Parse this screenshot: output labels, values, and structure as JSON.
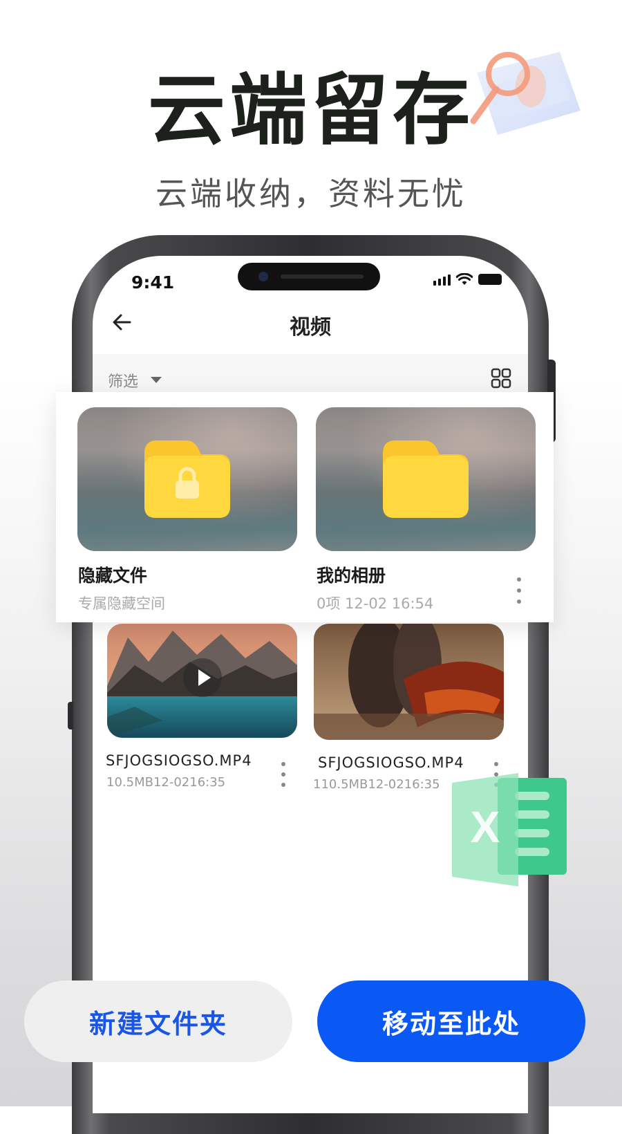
{
  "hero": {
    "title": "云端留存",
    "subtitle": "云端收纳，资料无忧"
  },
  "status_bar": {
    "time": "9:41"
  },
  "nav": {
    "title": "视频"
  },
  "filter": {
    "label": "筛选"
  },
  "folders": [
    {
      "name": "隐藏文件",
      "sub": "专属隐藏空间",
      "icon": "locked-folder-icon"
    },
    {
      "name": "我的相册",
      "sub": "0项 12-02 16:54",
      "icon": "folder-icon"
    }
  ],
  "videos": [
    {
      "name": "SFJOGSIOGSO.MP4",
      "meta": "10.5MB12-0216:35"
    },
    {
      "name": "SFJOGSIOGSO.MP4",
      "meta": "110.5MB12-0216:35"
    }
  ],
  "actions": {
    "new_folder": "新建文件夹",
    "move_here": "移动至此处"
  },
  "colors": {
    "primary": "#0a59f5",
    "folder_yellow": "#ffd43f",
    "excel_green": "#35c98a"
  }
}
